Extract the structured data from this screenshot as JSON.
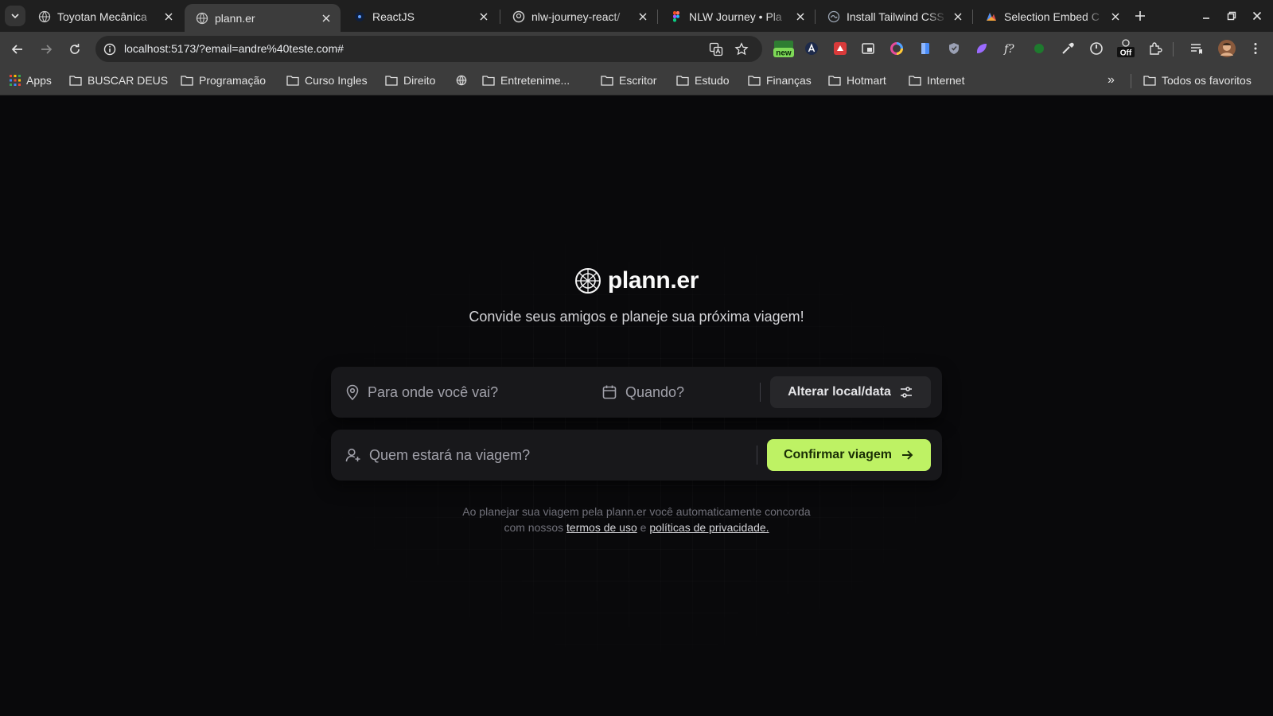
{
  "browser": {
    "tabs": [
      {
        "title": "Toyotan Mecânica",
        "icon": "globe-icon",
        "active": false
      },
      {
        "title": "plann.er",
        "icon": "globe-icon",
        "active": true
      },
      {
        "title": "ReactJS",
        "icon": "react-icon",
        "active": false
      },
      {
        "title": "nlw-journey-react/",
        "icon": "github-icon",
        "active": false
      },
      {
        "title": "NLW Journey • Pla",
        "icon": "figma-icon",
        "active": false
      },
      {
        "title": "Install Tailwind CSS",
        "icon": "tailwind-icon",
        "active": false
      },
      {
        "title": "Selection Embed C",
        "icon": "app-icon",
        "active": false
      }
    ],
    "url": "localhost:5173/?email=andre%40teste.com#",
    "extension_badges": {
      "new": "new",
      "off": "Off"
    },
    "bookmarks": [
      {
        "label": "Apps",
        "icon": "apps-grid-icon"
      },
      {
        "label": "BUSCAR DEUS",
        "icon": "folder-icon"
      },
      {
        "label": "Programação",
        "icon": "folder-icon"
      },
      {
        "label": "Curso Ingles",
        "icon": "folder-icon"
      },
      {
        "label": "Direito",
        "icon": "folder-icon"
      },
      {
        "label": "",
        "icon": "globe-icon"
      },
      {
        "label": "Entretenime...",
        "icon": "folder-icon"
      },
      {
        "label": "Escritor",
        "icon": "folder-icon"
      },
      {
        "label": "Estudo",
        "icon": "folder-icon"
      },
      {
        "label": "Finanças",
        "icon": "folder-icon"
      },
      {
        "label": "Hotmart",
        "icon": "folder-icon"
      },
      {
        "label": "Internet",
        "icon": "folder-icon"
      }
    ],
    "all_bookmarks": "Todos os favoritos",
    "more_bookmarks": "»"
  },
  "app": {
    "brand": "plann.er",
    "tagline": "Convide seus amigos e planeje sua próxima viagem!",
    "destination_placeholder": "Para onde você vai?",
    "date_placeholder": "Quando?",
    "change_button": "Alterar local/data",
    "guests_placeholder": "Quem estará na viagem?",
    "confirm_button": "Confirmar viagem",
    "terms_line1": "Ao planejar sua viagem pela plann.er você automaticamente concorda",
    "terms_prefix": "com nossos",
    "terms_link": "termos de uso",
    "terms_and": "e",
    "privacy_link": "políticas de privacidade."
  },
  "colors": {
    "background": "#09090b",
    "card": "#18181b",
    "accent": "#bef264",
    "muted_text": "#a1a1aa"
  }
}
